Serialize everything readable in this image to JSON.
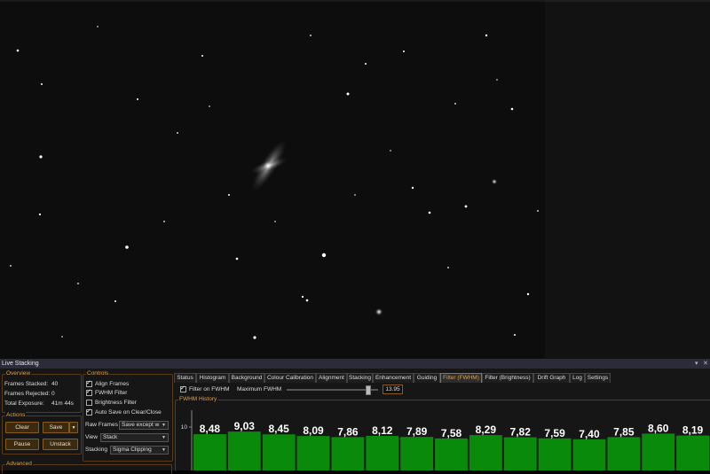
{
  "panel": {
    "title": "Live Stacking"
  },
  "overview": {
    "label": "Overview",
    "frames_stacked_label": "Frames Stacked:",
    "frames_stacked": "40",
    "frames_rejected_label": "Frames Rejected:",
    "frames_rejected": "0",
    "total_exposure_label": "Total Exposure:",
    "total_exposure": "41m 44s"
  },
  "actions": {
    "label": "Actions",
    "clear": "Clear",
    "save": "Save",
    "pause": "Pause",
    "unstack": "Unstack"
  },
  "advanced": {
    "label": "Advanced"
  },
  "controls": {
    "label": "Controls",
    "align_frames": "Align Frames",
    "fwhm_filter": "FWHM Filter",
    "brightness_filter": "Brightness Filter",
    "auto_save": "Auto Save on Clear/Close",
    "raw_frames_label": "Raw Frames",
    "raw_frames_value": "Save except w",
    "view_label": "View",
    "view_value": "Stack",
    "stacking_label": "Stacking",
    "stacking_value": "Sigma Clipping"
  },
  "tabs": [
    "Status",
    "Histogram",
    "Background",
    "Colour Calibration",
    "Alignment",
    "Stacking",
    "Enhancement",
    "Guiding",
    "Filter (FWHM)",
    "Filter (Brightness)",
    "Drift Graph",
    "Log",
    "Settings"
  ],
  "active_tab": "Filter (FWHM)",
  "filter": {
    "filter_on_fwhm": "Filter on FWHM",
    "maximum_fwhm_label": "Maximum FWHM",
    "maximum_fwhm_value": "13.95",
    "slider_fraction": 0.88
  },
  "chart_data": {
    "type": "bar",
    "title": "FWHM History",
    "ytick_label": "10",
    "values": [
      8.48,
      9.03,
      8.45,
      8.09,
      7.86,
      8.12,
      7.89,
      7.58,
      8.29,
      7.82,
      7.59,
      7.4,
      7.85,
      8.6,
      8.19
    ],
    "labels": [
      "8,48",
      "9,03",
      "8,45",
      "8,09",
      "7,86",
      "8,12",
      "7,89",
      "7,58",
      "8,29",
      "7,82",
      "7,59",
      "7,40",
      "7,85",
      "8,60",
      "8,19"
    ],
    "bar_color": "#0a8a0a",
    "label_color": "#ffffff"
  },
  "colors": {
    "accent": "#e0a040",
    "panel_bg": "#161616",
    "sky_bg": "#0d0d0d"
  }
}
